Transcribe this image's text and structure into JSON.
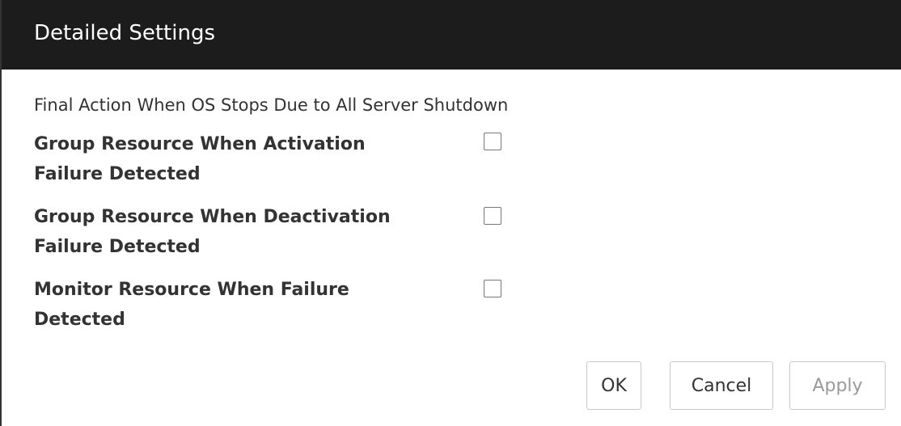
{
  "dialog": {
    "title": "Detailed Settings",
    "section_label": "Final Action When OS Stops Due to All Server Shutdown",
    "options": [
      {
        "label_line1": "Group Resource When Activation",
        "label_line2": "Failure Detected",
        "checked": false
      },
      {
        "label_line1": "Group Resource When Deactivation",
        "label_line2": "Failure Detected",
        "checked": false
      },
      {
        "label_line1": "Monitor Resource When Failure",
        "label_line2": "Detected",
        "checked": false
      }
    ],
    "buttons": {
      "ok": "OK",
      "cancel": "Cancel",
      "apply": "Apply"
    }
  },
  "colors": {
    "titlebar_bg": "#1c1c1c",
    "text": "#333333",
    "disabled_text": "#9a9a9a"
  }
}
